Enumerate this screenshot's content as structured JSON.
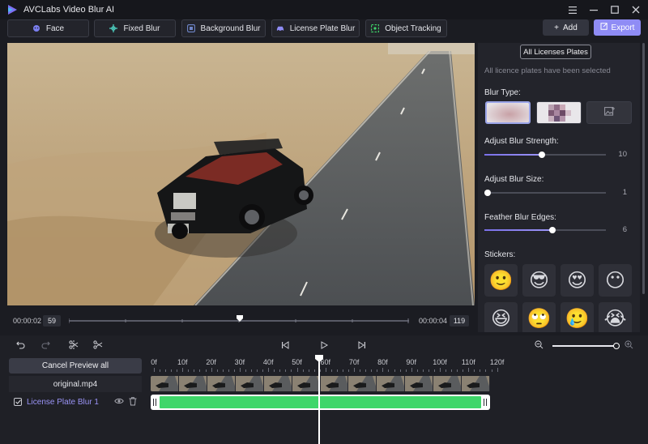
{
  "app": {
    "title": "AVCLabs Video Blur AI",
    "accent_color": "#8f8cf5",
    "window_controls": [
      "menu-icon",
      "minimize-icon",
      "maximize-icon",
      "close-icon"
    ]
  },
  "toolbar": {
    "tabs": [
      {
        "label": "Face",
        "icon": "face-icon",
        "color": "#7b7ff0"
      },
      {
        "label": "Fixed Blur",
        "icon": "crosshair-icon",
        "color": "#4fd6c6"
      },
      {
        "label": "Background Blur",
        "icon": "background-icon",
        "color": "#6f86c9"
      },
      {
        "label": "License Plate Blur",
        "icon": "car-icon",
        "color": "#8f8cf5"
      },
      {
        "label": "Object Tracking",
        "icon": "target-icon",
        "color": "#3fd66a"
      }
    ],
    "add_label": "Add",
    "export_label": "Export"
  },
  "preview": {
    "start_time": "00:00:02",
    "start_frame": "59",
    "end_time": "00:00:04",
    "end_frame": "119"
  },
  "panel": {
    "all_plates_label": "All Licenses Plates",
    "selected_note": "All licence plates have been selected",
    "blur_type_label": "Blur Type:",
    "blur_options": [
      "gaussian-blur",
      "mosaic-blur",
      "image-upload-icon"
    ],
    "strength": {
      "label": "Adjust Blur Strength:",
      "value": "10",
      "fraction": 0.47
    },
    "size": {
      "label": "Adjust Blur Size:",
      "value": "1",
      "fraction": 0.0
    },
    "feather": {
      "label": "Feather Blur Edges:",
      "value": "6",
      "fraction": 0.56
    },
    "stickers_label": "Stickers:",
    "stickers": [
      "🙂",
      "😎",
      "😍",
      "😶",
      "😆",
      "🙄",
      "🥲",
      "😭"
    ]
  },
  "timeline": {
    "cancel_preview_label": "Cancel Preview all",
    "file_name": "original.mp4",
    "layer_name": "License Plate Blur 1",
    "ruler_labels": [
      "0f",
      "10f",
      "20f",
      "30f",
      "40f",
      "50f",
      "60f",
      "70f",
      "80f",
      "90f",
      "100f",
      "110f",
      "120f"
    ],
    "playhead_frame": 59,
    "track_color": "#3fd66a"
  }
}
